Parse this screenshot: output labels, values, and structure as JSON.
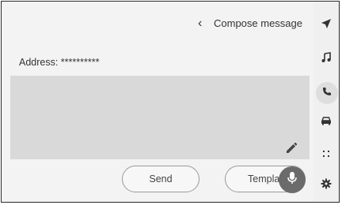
{
  "header": {
    "back_icon": "chevron-left-icon",
    "title": "Compose message"
  },
  "address": {
    "text": "Address: **********"
  },
  "editor": {
    "edit_icon": "pencil-icon"
  },
  "actions": {
    "send_label": "Send",
    "template_label": "Template",
    "mic_icon": "microphone-icon"
  },
  "sidebar": {
    "items": [
      {
        "icon": "navigation-arrow-icon",
        "active": false
      },
      {
        "icon": "music-note-icon",
        "active": false
      },
      {
        "icon": "phone-icon",
        "active": true
      },
      {
        "icon": "car-icon",
        "active": false
      },
      {
        "icon": "apps-grid-icon",
        "active": false
      },
      {
        "icon": "gear-icon",
        "active": false
      }
    ]
  },
  "colors": {
    "background": "#f3f3f3",
    "message_area": "#d9d9d9",
    "mic_button": "#6b6b6b",
    "text": "#333333"
  }
}
